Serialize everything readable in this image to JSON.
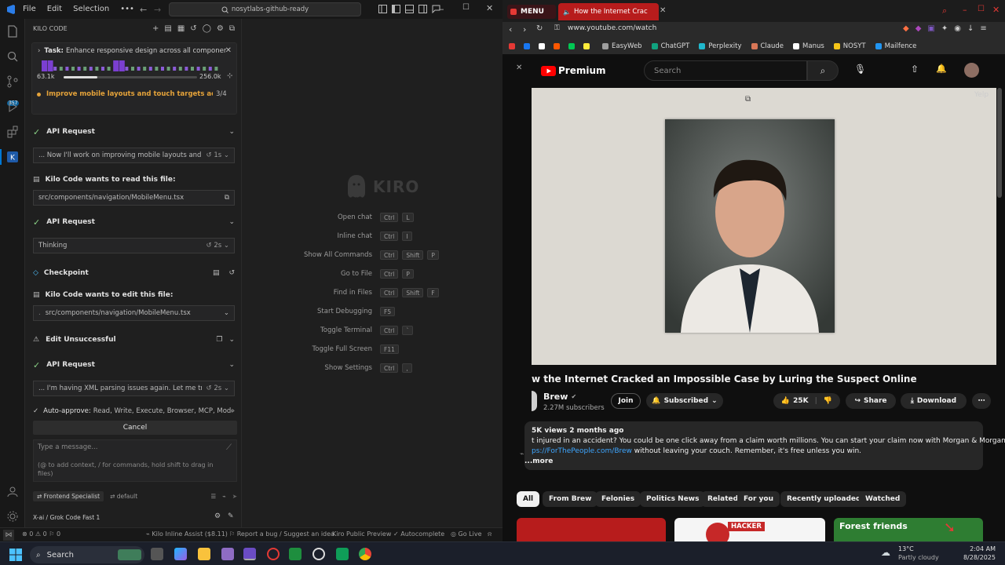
{
  "vscode": {
    "menu": [
      "File",
      "Edit",
      "Selection"
    ],
    "search_text": "nosytlabs-github-ready",
    "activity_badge": "357",
    "panel_title": "KILO CODE",
    "task": {
      "label": "Task:",
      "text": "Enhance responsive design across all component...",
      "tokens_left": "63.1k",
      "tokens_right": "256.0k",
      "todo_text": "Improve mobile layouts and touch targets across co...",
      "todo_count": "3/4",
      "progress": 0.25
    },
    "items": [
      {
        "title": "API Request"
      },
      {
        "box": "... Now I'll work on improving mobile layouts and to...",
        "time": "1s"
      },
      {
        "title": "Kilo Code wants to read this file:"
      },
      {
        "box": "src/components/navigation/MobileMenu.tsx"
      },
      {
        "title": "API Request"
      },
      {
        "box": "Thinking",
        "time": "2s"
      },
      {
        "title": "Checkpoint"
      },
      {
        "title": "Kilo Code wants to edit this file:"
      },
      {
        "box": "src/components/navigation/MobileMenu.tsx"
      },
      {
        "title": "Edit Unsuccessful"
      },
      {
        "title": "API Request"
      },
      {
        "box": "... I'm having XML parsing issues again. Let me try a ...",
        "time": "2s"
      }
    ],
    "auto_approve": {
      "label": "Auto-approve:",
      "text": "Read, Write, Execute, Browser, MCP, Mode, ..."
    },
    "cancel": "Cancel",
    "input_placeholder": "Type a message...",
    "input_hint": "(@ to add context, / for commands, hold shift to drag in files)",
    "mode": "Frontend Specialist",
    "profile": "default",
    "model": "X-ai / Grok Code Fast 1",
    "editor": {
      "logo": "KIRO",
      "shortcuts": [
        {
          "label": "Open chat",
          "keys": [
            "Ctrl",
            "L"
          ]
        },
        {
          "label": "Inline chat",
          "keys": [
            "Ctrl",
            "I"
          ]
        },
        {
          "label": "Show All Commands",
          "keys": [
            "Ctrl",
            "Shift",
            "P"
          ]
        },
        {
          "label": "Go to File",
          "keys": [
            "Ctrl",
            "P"
          ]
        },
        {
          "label": "Find in Files",
          "keys": [
            "Ctrl",
            "Shift",
            "F"
          ]
        },
        {
          "label": "Start Debugging",
          "keys": [
            "F5"
          ]
        },
        {
          "label": "Toggle Terminal",
          "keys": [
            "Ctrl",
            "`"
          ]
        },
        {
          "label": "Toggle Full Screen",
          "keys": [
            "F11"
          ]
        },
        {
          "label": "Show Settings",
          "keys": [
            "Ctrl",
            ","
          ]
        }
      ]
    },
    "status": {
      "left": "⊗ 0  ⚠ 0   ⚐ 0",
      "items": [
        "Kilo Inline Assist ($8.11)",
        "Report a bug / Suggest an idea",
        "Kiro Public Preview",
        "Autocomplete",
        "Go Live"
      ]
    }
  },
  "browser": {
    "tabs": [
      {
        "label": "MENU"
      },
      {
        "label": "How the Internet Crac"
      }
    ],
    "url": "www.youtube.com/watch",
    "bookmarks": [
      "EasyWeb",
      "ChatGPT",
      "Perplexity",
      "Claude",
      "Manus",
      "NOSYT",
      "Mailfence"
    ],
    "bookmark_colors": [
      "#e53935",
      "#1877f2",
      "#ffffff",
      "#ff5700",
      "#00c853",
      "#ffeb3b",
      "#9e9e9e",
      "#10a37f",
      "#20b8cd",
      "#d97757",
      "#ffffff",
      "#f5c518",
      "#2196f3"
    ],
    "youtube": {
      "logo": "Premium",
      "search_placeholder": "Search",
      "watermark": "Yelp",
      "title": "w the Internet Cracked an Impossible Case by Luring the Suspect Online",
      "channel": "Brew",
      "subscribers": "2.27M subscribers",
      "join": "Join",
      "subscribed": "Subscribed",
      "likes": "25K",
      "share": "Share",
      "download": "Download",
      "views": "5K views  2 months ago",
      "desc1": "t injured in an accident? You could be one click away from a claim worth millions. You can start your claim now with Morgan & Morgan at",
      "desc2_link": "ps://ForThePeople.com/Brew",
      "desc2_rest": " without leaving your couch. Remember, it's free unless you win.",
      "more": "...more",
      "chips": [
        "All",
        "From Brew",
        "Felonies",
        "Politics News",
        "Related",
        "For you",
        "Recently uploaded",
        "Watched"
      ],
      "thumb_labels": [
        "HACKER",
        "Forest friends"
      ]
    }
  },
  "taskbar": {
    "search": "Search",
    "weather_temp": "13°C",
    "weather_text": "Partly cloudy",
    "time": "2:04 AM",
    "date": "8/28/2025"
  }
}
